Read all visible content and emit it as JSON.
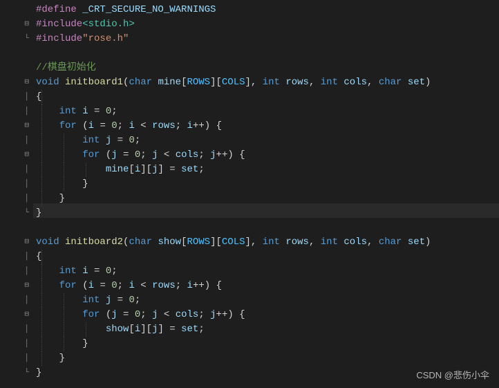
{
  "tokens": {
    "define": "#define",
    "crt": " _CRT_SECURE_NO_WARNINGS",
    "include": "#include",
    "lt": "<",
    "gt": ">",
    "stdio": "stdio.h",
    "quote": "\"",
    "rose": "rose.h",
    "comment1": "//棋盘初始化",
    "kvoid": "void",
    "f1": "initboard1",
    "f2": "initboard2",
    "tchar": "char",
    "tint": "int",
    "mine": "mine",
    "show": "show",
    "rows_c": "ROWS",
    "cols_c": "COLS",
    "rows": "rows",
    "cols": "cols",
    "set": "set",
    "i": "i",
    "j": "j",
    "eq": " = ",
    "zero": "0",
    "semi": ";",
    "kfor": "for",
    "sp": " ",
    "lp": "(",
    "rp": ")",
    "lb": "[",
    "rb": "]",
    "lc": "{",
    "rc": "}",
    "ltop": " < ",
    "inc": "++",
    "comma": ", "
  },
  "fold": {
    "minus": "⊟",
    "bar": "│",
    "corner": "└"
  },
  "watermark": "CSDN @悲伤小伞"
}
